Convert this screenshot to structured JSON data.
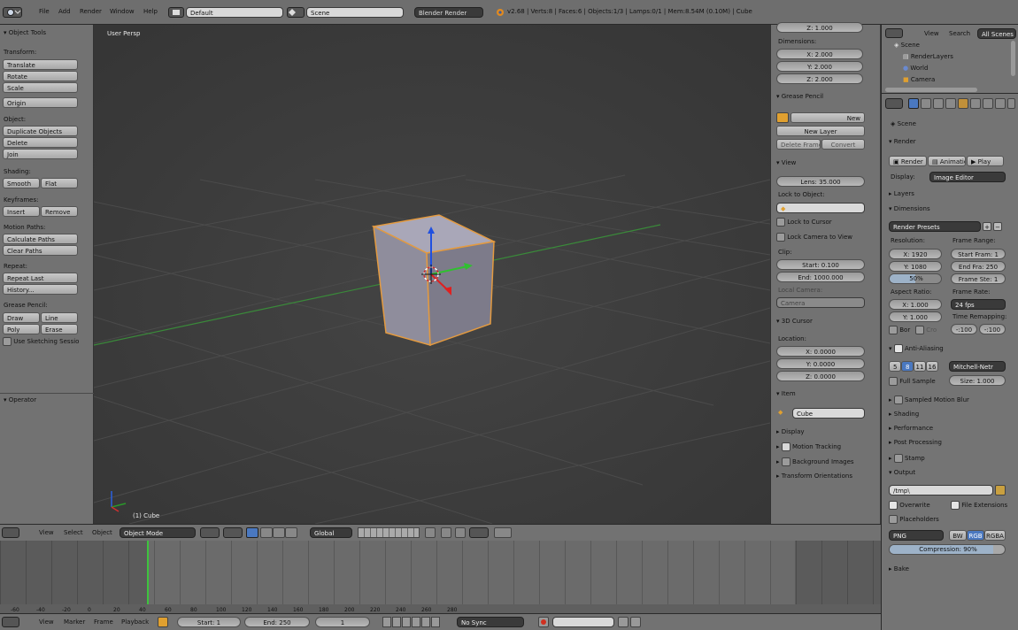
{
  "topbar": {
    "menus": [
      "File",
      "Add",
      "Render",
      "Window",
      "Help"
    ],
    "layout": "Default",
    "scene": "Scene",
    "engine": "Blender Render",
    "info": "v2.68 | Verts:8 | Faces:6 | Objects:1/3 | Lamps:0/1 | Mem:8.54M (0.10M) | Cube"
  },
  "toolshelf": {
    "title": "Object Tools",
    "transform_header": "Transform:",
    "transform": [
      "Translate",
      "Rotate",
      "Scale"
    ],
    "origin": "Origin",
    "object_header": "Object:",
    "object": [
      "Duplicate Objects",
      "Delete",
      "Join"
    ],
    "shading_header": "Shading:",
    "smooth": "Smooth",
    "flat": "Flat",
    "keyframes_header": "Keyframes:",
    "insert": "Insert",
    "remove": "Remove",
    "motion_header": "Motion Paths:",
    "motion": [
      "Calculate Paths",
      "Clear Paths"
    ],
    "repeat_header": "Repeat:",
    "repeat": [
      "Repeat Last",
      "History..."
    ],
    "grease_header": "Grease Pencil:",
    "draw": "Draw",
    "line": "Line",
    "poly": "Poly",
    "erase": "Erase",
    "sketch": "Use Sketching Sessio",
    "operator": "Operator"
  },
  "viewport": {
    "label": "User Persp",
    "object_label": "(1) Cube"
  },
  "npanel": {
    "top_value": "Z: 1.000",
    "dimensions_header": "Dimensions:",
    "dims": [
      "X: 2.000",
      "Y: 2.000",
      "Z: 2.000"
    ],
    "grease_header": "Grease Pencil",
    "new": "New",
    "new_layer": "New Layer",
    "delete_frame": "Delete Frame",
    "convert": "Convert",
    "view_header": "View",
    "lens": "Lens: 35.000",
    "lock_to_object": "Lock to Object:",
    "lock_to_cursor": "Lock to Cursor",
    "lock_camera": "Lock Camera to View",
    "clip": "Clip:",
    "clip_start": "Start: 0.100",
    "clip_end": "End: 1000.000",
    "local_camera": "Local Camera:",
    "camera": "Camera",
    "cursor_header": "3D Cursor",
    "location": "Location:",
    "cursor": [
      "X: 0.0000",
      "Y: 0.0000",
      "Z: 0.0000"
    ],
    "item_header": "Item",
    "item_name": "Cube",
    "display": "Display",
    "motion_tracking": "Motion Tracking",
    "background_images": "Background Images",
    "transform_orientations": "Transform Orientations"
  },
  "outliner": {
    "view": "View",
    "search": "Search",
    "all_scenes": "All Scenes",
    "items": [
      "Scene",
      "RenderLayers",
      "World",
      "Camera"
    ]
  },
  "props": {
    "scene": "Scene",
    "render_header": "Render",
    "render": "Render",
    "animation": "Animation",
    "play": "Play",
    "display_label": "Display:",
    "display_value": "Image Editor",
    "layers": "Layers",
    "dimensions": "Dimensions",
    "presets": "Render Presets",
    "resolution": "Resolution:",
    "res_x": "X: 1920",
    "res_y": "Y: 1080",
    "res_pct": "50%",
    "frame_range": "Frame Range:",
    "start_frame": "Start Fram: 1",
    "end_frame": "End Fra: 250",
    "frame_step": "Frame Ste: 1",
    "aspect": "Aspect Ratio:",
    "asp_x": "X: 1.000",
    "asp_y": "Y: 1.000",
    "frame_rate": "Frame Rate:",
    "fps": "24 fps",
    "time_remap": "Time Remapping:",
    "remap_old": "-:100",
    "remap_new": "-:100",
    "border": "Bor",
    "crop": "Cro",
    "anti_aliasing": "Anti-Aliasing",
    "aa_samples": [
      "5",
      "8",
      "11",
      "16"
    ],
    "filter": "Mitchell-Netr",
    "full_sample": "Full Sample",
    "size": "Size: 1.000",
    "sampled_motion_blur": "Sampled Motion Blur",
    "shading": "Shading",
    "performance": "Performance",
    "post_processing": "Post Processing",
    "stamp": "Stamp",
    "output": "Output",
    "output_path": "/tmp\\",
    "overwrite": "Overwrite",
    "file_extensions": "File Extensions",
    "placeholders": "Placeholders",
    "format": "PNG",
    "bw": "BW",
    "rgb": "RGB",
    "rgba": "RGBA",
    "compression": "Compression: 90%",
    "bake": "Bake"
  },
  "timeline_header": {
    "view": "View",
    "select": "Select",
    "object": "Object",
    "mode": "Object Mode",
    "orientation": "Global"
  },
  "ruler_ticks": [
    "-60",
    "-40",
    "-20",
    "0",
    "20",
    "40",
    "60",
    "80",
    "100",
    "120",
    "140",
    "160",
    "180",
    "200",
    "220",
    "240",
    "260",
    "280"
  ],
  "timeline_bottom": {
    "view": "View",
    "marker": "Marker",
    "frame": "Frame",
    "playback": "Playback",
    "start": "Start: 1",
    "end": "End: 250",
    "current": "1",
    "sync": "No Sync"
  }
}
